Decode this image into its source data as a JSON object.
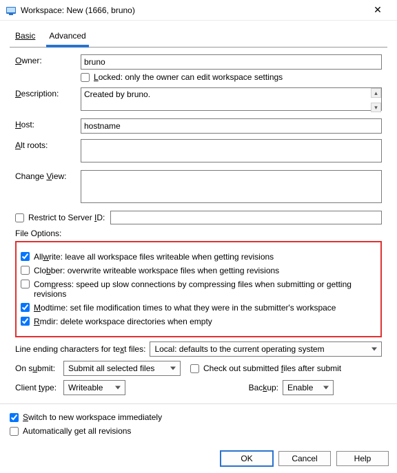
{
  "window": {
    "title": "Workspace: New (1666, bruno)"
  },
  "tabs": {
    "basic": "Basic",
    "advanced": "Advanced"
  },
  "labels": {
    "owner": "Owner:",
    "locked": "Locked: only the owner can edit workspace settings",
    "description": "Description:",
    "host": "Host:",
    "altroots": "Alt roots:",
    "changeview": "Change View:",
    "restrict": "Restrict to Server ID:",
    "fileoptions": "File Options:",
    "lineending": "Line ending characters for text files:",
    "onsubmit": "On submit:",
    "clienttype": "Client type:",
    "backup": "Backup:",
    "checkout": "Check out submitted files after submit",
    "switch": "Switch to new workspace immediately",
    "autoget": "Automatically get all revisions"
  },
  "values": {
    "owner": "bruno",
    "description": "Created by bruno.",
    "host": "hostname"
  },
  "fileopts": {
    "allwrite": "Allwrite: leave all workspace files writeable when getting revisions",
    "clobber": "Clobber: overwrite writeable workspace files when getting revisions",
    "compress": "Compress: speed up slow connections by compressing files when submitting or getting revisions",
    "modtime": "Modtime: set file modification times to what they were in the submitter's workspace",
    "rmdir": "Rmdir: delete workspace directories when empty"
  },
  "selects": {
    "lineending": "Local: defaults to the current operating system",
    "onsubmit": "Submit all selected files",
    "clienttype": "Writeable",
    "backup": "Enable"
  },
  "buttons": {
    "ok": "OK",
    "cancel": "Cancel",
    "help": "Help"
  }
}
